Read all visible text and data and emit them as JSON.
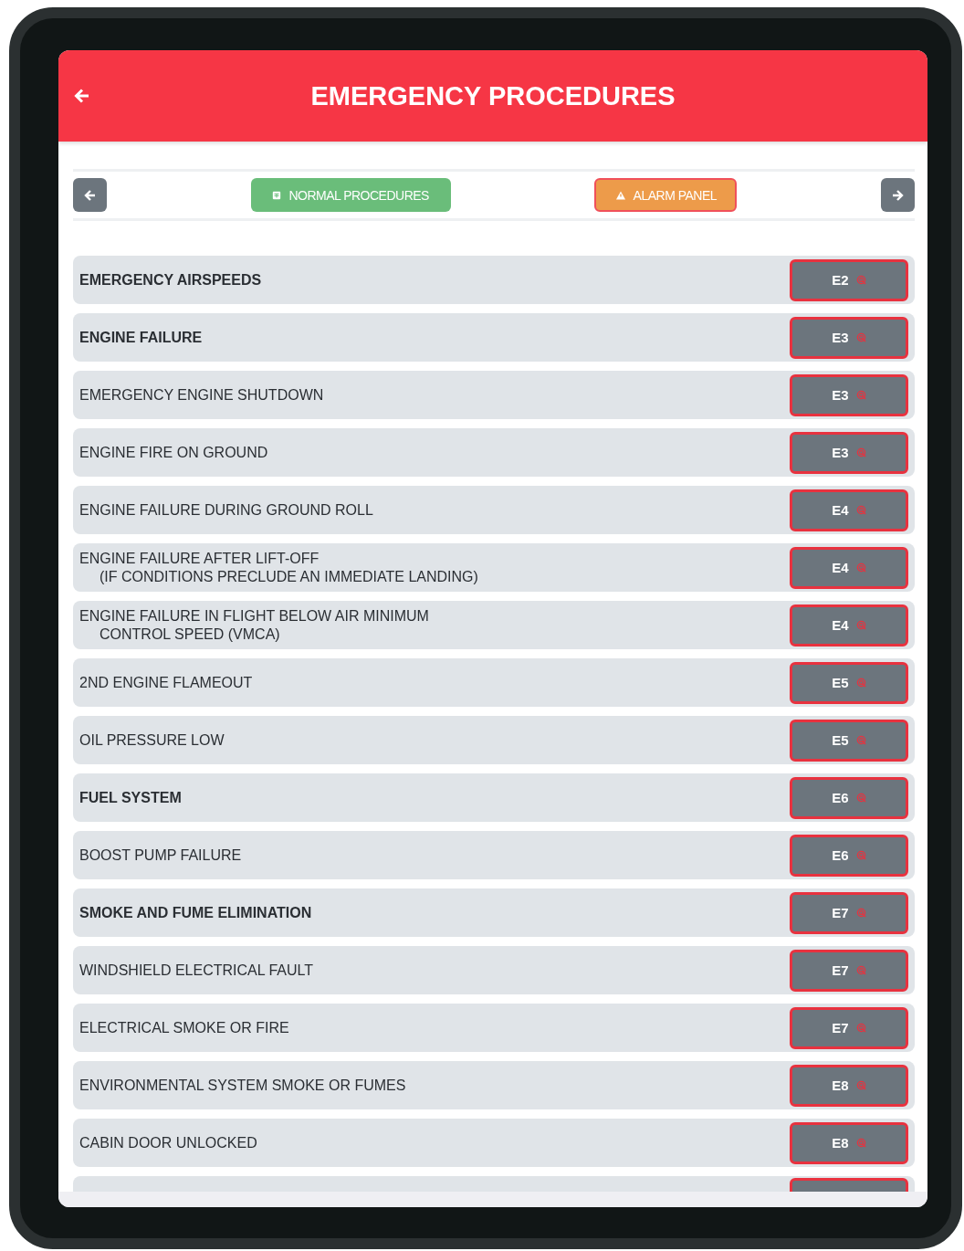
{
  "header": {
    "title": "EMERGENCY PROCEDURES"
  },
  "nav": {
    "links": [
      {
        "label": "NORMAL PROCEDURES",
        "kind": "normal"
      },
      {
        "label": "ALARM PANEL",
        "kind": "alarm"
      }
    ]
  },
  "procedures": [
    {
      "lines": [
        "EMERGENCY AIRSPEEDS"
      ],
      "kind": "section",
      "page": "E2"
    },
    {
      "lines": [
        "ENGINE FAILURE"
      ],
      "kind": "section",
      "page": "E3"
    },
    {
      "lines": [
        "EMERGENCY ENGINE SHUTDOWN"
      ],
      "kind": "item",
      "page": "E3"
    },
    {
      "lines": [
        "ENGINE FIRE ON GROUND"
      ],
      "kind": "item",
      "page": "E3"
    },
    {
      "lines": [
        "ENGINE FAILURE DURING GROUND ROLL"
      ],
      "kind": "item",
      "page": "E4"
    },
    {
      "lines": [
        "ENGINE FAILURE AFTER LIFT-OFF",
        "(IF CONDITIONS PRECLUDE AN IMMEDIATE LANDING)"
      ],
      "kind": "item",
      "page": "E4"
    },
    {
      "lines": [
        "ENGINE FAILURE IN FLIGHT BELOW AIR MINIMUM",
        "CONTROL SPEED (VMCA)"
      ],
      "kind": "item",
      "page": "E4"
    },
    {
      "lines": [
        "2ND ENGINE FLAMEOUT"
      ],
      "kind": "item",
      "page": "E5"
    },
    {
      "lines": [
        "OIL PRESSURE LOW"
      ],
      "kind": "item",
      "page": "E5"
    },
    {
      "lines": [
        "FUEL SYSTEM"
      ],
      "kind": "section",
      "page": "E6"
    },
    {
      "lines": [
        "BOOST PUMP FAILURE"
      ],
      "kind": "item",
      "page": "E6"
    },
    {
      "lines": [
        "SMOKE AND FUME ELIMINATION"
      ],
      "kind": "section",
      "page": "E7"
    },
    {
      "lines": [
        "WINDSHIELD ELECTRICAL FAULT"
      ],
      "kind": "item",
      "page": "E7"
    },
    {
      "lines": [
        "ELECTRICAL SMOKE OR FIRE"
      ],
      "kind": "item",
      "page": "E7"
    },
    {
      "lines": [
        "ENVIRONMENTAL SYSTEM SMOKE OR FUMES"
      ],
      "kind": "item",
      "page": "E8"
    },
    {
      "lines": [
        "CABIN DOOR UNLOCKED"
      ],
      "kind": "item",
      "page": "E8"
    }
  ]
}
